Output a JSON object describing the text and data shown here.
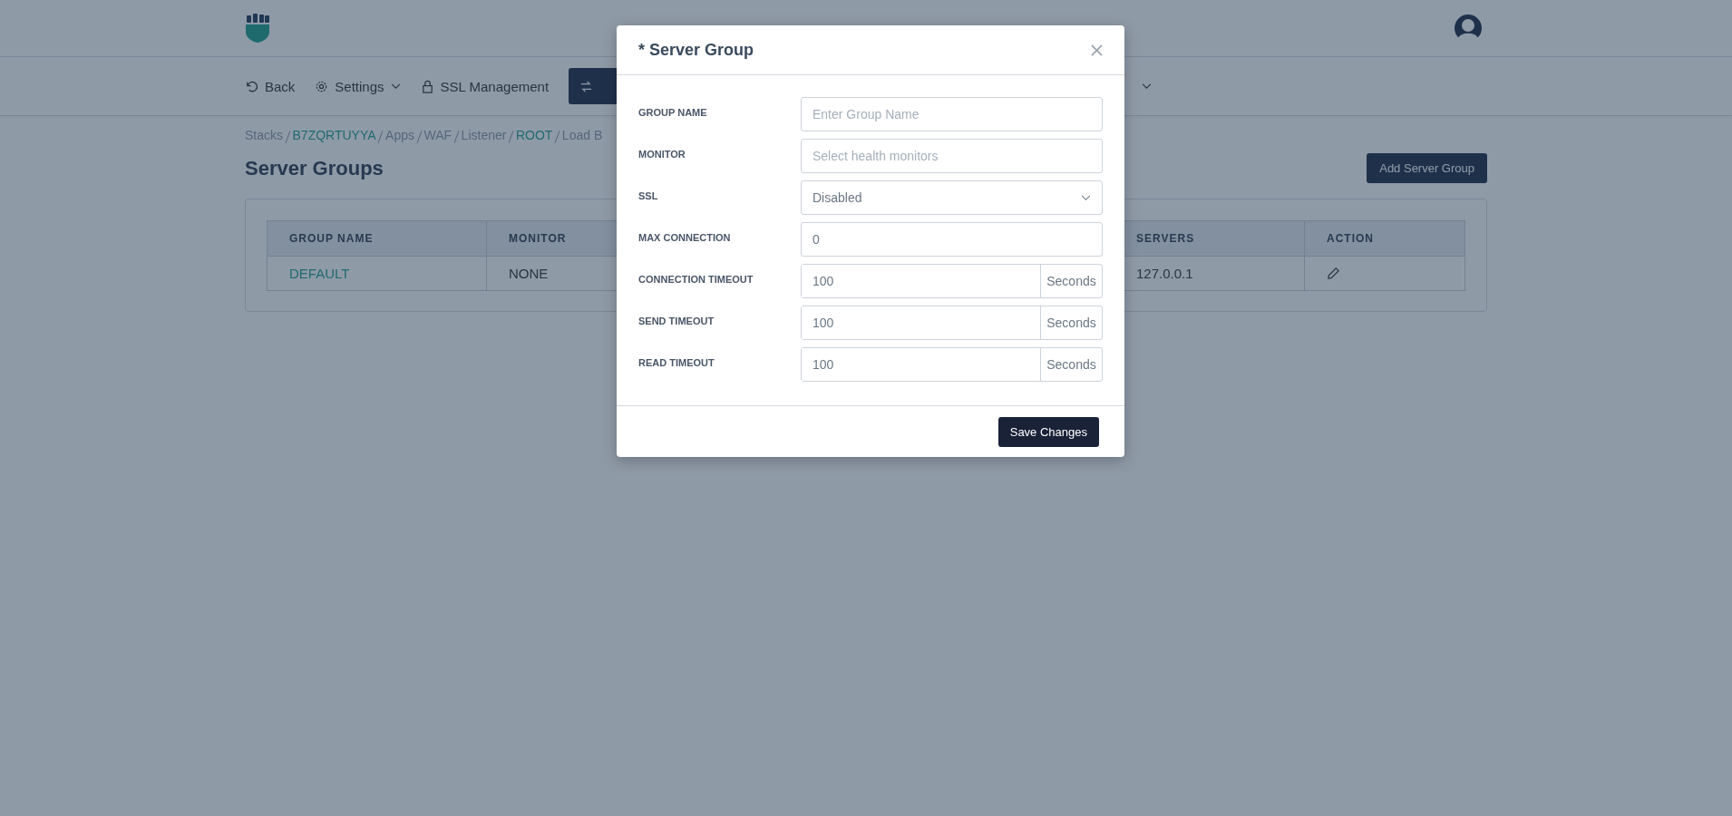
{
  "nav": [
    {
      "label": "Back",
      "dropdown": false
    },
    {
      "label": "Settings",
      "dropdown": true
    },
    {
      "label": "SSL Management",
      "dropdown": false
    }
  ],
  "breadcrumb": [
    {
      "label": "Stacks",
      "link": false
    },
    {
      "label": "B7ZQRTUYYA",
      "link": true
    },
    {
      "label": "Apps",
      "link": false
    },
    {
      "label": "WAF",
      "link": false
    },
    {
      "label": "Listener",
      "link": false
    },
    {
      "label": "ROOT",
      "link": true
    },
    {
      "label": "Load B",
      "link": false
    }
  ],
  "page_title": "Server Groups",
  "add_button": "Add Server Group",
  "table": {
    "columns": [
      "GROUP NAME",
      "MONITOR",
      "SERVERS",
      "ACTION"
    ],
    "rows": [
      {
        "group_name": "DEFAULT",
        "monitor": "NONE",
        "servers": "127.0.0.1"
      }
    ]
  },
  "modal": {
    "title": "* Server Group",
    "fields": [
      {
        "kind": "text",
        "label": "GROUP NAME",
        "placeholder": "Enter Group Name"
      },
      {
        "kind": "text",
        "label": "MONITOR",
        "placeholder": "Select health monitors"
      },
      {
        "kind": "select",
        "label": "SSL",
        "value": "Disabled"
      },
      {
        "kind": "text",
        "label": "MAX CONNECTION",
        "value": "0"
      },
      {
        "kind": "suffix",
        "label": "CONNECTION TIMEOUT",
        "value": "100",
        "suffix": "Seconds"
      },
      {
        "kind": "suffix",
        "label": "SEND TIMEOUT",
        "value": "100",
        "suffix": "Seconds"
      },
      {
        "kind": "suffix",
        "label": "READ TIMEOUT",
        "value": "100",
        "suffix": "Seconds"
      }
    ],
    "save_button": "Save Changes"
  }
}
